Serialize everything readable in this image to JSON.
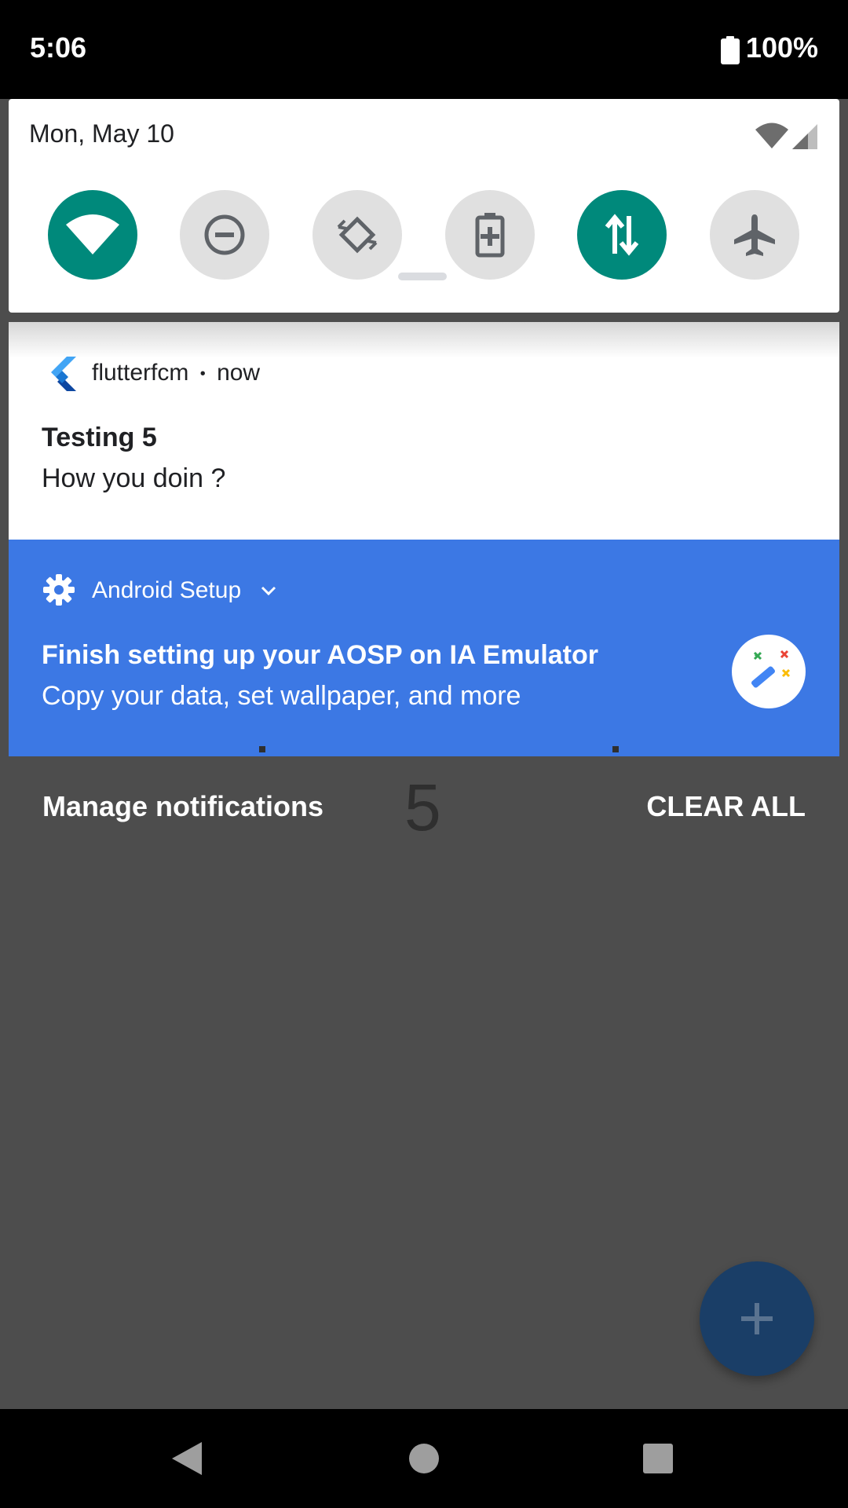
{
  "status_bar": {
    "time": "5:06",
    "battery_percent": "100%",
    "icons": [
      "battery-icon"
    ]
  },
  "quick_settings": {
    "date": "Mon, May 10",
    "indicators": [
      "wifi-icon",
      "cell-signal-icon"
    ],
    "tiles": [
      {
        "name": "wifi",
        "icon": "wifi-icon",
        "state": "on"
      },
      {
        "name": "do-not-disturb",
        "icon": "do-not-disturb-icon",
        "state": "off"
      },
      {
        "name": "auto-rotate",
        "icon": "rotate-icon",
        "state": "off"
      },
      {
        "name": "battery-saver",
        "icon": "battery-saver-icon",
        "state": "off"
      },
      {
        "name": "mobile-data",
        "icon": "mobile-data-icon",
        "state": "on"
      },
      {
        "name": "airplane-mode",
        "icon": "airplane-icon",
        "state": "off"
      }
    ]
  },
  "notifications": [
    {
      "app_name": "flutterfcm",
      "separator": "•",
      "time": "now",
      "title": "Testing 5",
      "body": "How you doin ?",
      "icon": "flutter-logo-icon"
    },
    {
      "app_name": "Android Setup",
      "icon": "gear-icon",
      "title": "Finish setting up your AOSP on IA Emulator",
      "body": "Copy your data, set wallpaper, and more",
      "badge_icon": "magic-wand-icon"
    }
  ],
  "footer": {
    "manage_label": "Manage notifications",
    "clear_label": "CLEAR ALL"
  },
  "background_app": {
    "counter_value": "5",
    "fab_icon": "plus-icon"
  },
  "nav_bar": {
    "icons": [
      "back-icon",
      "home-icon",
      "recents-icon"
    ]
  },
  "colors": {
    "accent_teal": "#00897b",
    "setup_blue": "#3c78e4",
    "scrim": "#4d4d4d",
    "fab": "#1a3e67"
  }
}
